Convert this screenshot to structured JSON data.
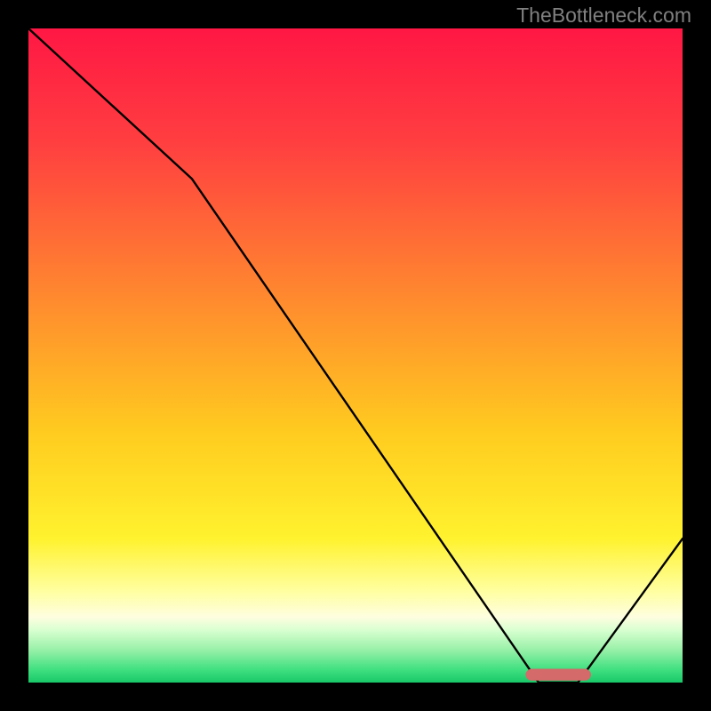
{
  "watermark": "TheBottleneck.com",
  "chart_data": {
    "type": "line",
    "title": "",
    "xlabel": "",
    "ylabel": "",
    "xlim": [
      0,
      100
    ],
    "ylim": [
      0,
      100
    ],
    "grid": false,
    "legend": false,
    "x": [
      0,
      25,
      78,
      84,
      100
    ],
    "values": [
      100,
      77,
      0,
      0,
      22
    ],
    "gradient_stops": [
      {
        "offset": 0,
        "color": "#ff1744"
      },
      {
        "offset": 18,
        "color": "#ff4040"
      },
      {
        "offset": 42,
        "color": "#ff8c2e"
      },
      {
        "offset": 62,
        "color": "#ffcc1f"
      },
      {
        "offset": 78,
        "color": "#fff22e"
      },
      {
        "offset": 86,
        "color": "#ffffa0"
      },
      {
        "offset": 90,
        "color": "#fefee0"
      },
      {
        "offset": 92,
        "color": "#d8ffd0"
      },
      {
        "offset": 95,
        "color": "#98f0a8"
      },
      {
        "offset": 98,
        "color": "#40e080"
      },
      {
        "offset": 100,
        "color": "#18c868"
      }
    ],
    "flat_marker": {
      "x0": 76,
      "x1": 86,
      "y": 1.2,
      "color": "#d46a6a"
    }
  }
}
